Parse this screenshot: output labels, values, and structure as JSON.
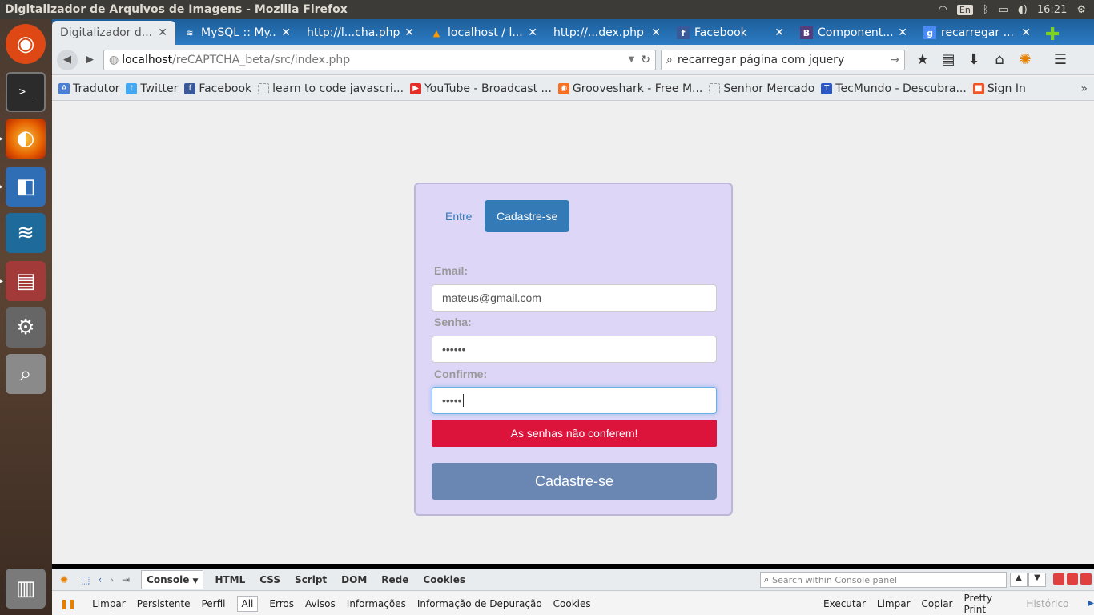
{
  "window": {
    "title": "Digitalizador de Arquivos de Imagens - Mozilla Firefox"
  },
  "tray": {
    "lang": "En",
    "time": "16:21"
  },
  "launcher": {
    "items": [
      {
        "name": "ubuntu-icon",
        "glyph": "◉"
      },
      {
        "name": "terminal-icon",
        "glyph": ">_"
      },
      {
        "name": "firefox-icon",
        "glyph": "◐"
      },
      {
        "name": "virtualbox-icon",
        "glyph": "◧"
      },
      {
        "name": "mysql-workbench-icon",
        "glyph": "≋"
      },
      {
        "name": "file-manager-icon",
        "glyph": "▤"
      },
      {
        "name": "system-settings-icon",
        "glyph": "⚙"
      },
      {
        "name": "search-icon",
        "glyph": "⌕"
      },
      {
        "name": "trash-icon",
        "glyph": "🗑"
      }
    ]
  },
  "tabs": [
    {
      "label": "Digitalizador d...",
      "fav": "",
      "active": true
    },
    {
      "label": "MySQL :: My...",
      "fav": "≋"
    },
    {
      "label": "http://l...cha.php",
      "fav": ""
    },
    {
      "label": "localhost / l...",
      "fav": "▲"
    },
    {
      "label": "http://...dex.php",
      "fav": ""
    },
    {
      "label": "Facebook",
      "fav": "f"
    },
    {
      "label": "Component...",
      "fav": "B"
    },
    {
      "label": "recarregar ...",
      "fav": "g"
    }
  ],
  "nav": {
    "url_host": "localhost",
    "url_path": "/reCAPTCHA_beta/src/index.php",
    "search_value": "recarregar página com jquery"
  },
  "bookmarks": [
    {
      "label": "Tradutor",
      "fav": "A",
      "color": "#4a7fd6"
    },
    {
      "label": "Twitter",
      "fav": "t",
      "color": "#3fa9f5"
    },
    {
      "label": "Facebook",
      "fav": "f",
      "color": "#3b5998"
    },
    {
      "label": "learn to code javascri...",
      "fav": "",
      "color": "#cccccc"
    },
    {
      "label": "YouTube - Broadcast ...",
      "fav": "▶",
      "color": "#e52d27"
    },
    {
      "label": "Grooveshark - Free M...",
      "fav": "◉",
      "color": "#f76f20"
    },
    {
      "label": "Senhor Mercado",
      "fav": "",
      "color": "#cccccc"
    },
    {
      "label": "TecMundo - Descubra...",
      "fav": "T",
      "color": "#2d57c7"
    },
    {
      "label": "Sign In",
      "fav": "■",
      "color": "#f35325"
    }
  ],
  "form": {
    "tab_login": "Entre",
    "tab_register": "Cadastre-se",
    "email_label": "Email:",
    "email_value": "mateus@gmail.com",
    "password_label": "Senha:",
    "password_value": "••••••",
    "confirm_label": "Confirme:",
    "confirm_value": "•••••",
    "error_message": "As senhas não conferem!",
    "submit_label": "Cadastre-se"
  },
  "firebug": {
    "tabs": [
      "Console",
      "HTML",
      "CSS",
      "Script",
      "DOM",
      "Rede",
      "Cookies"
    ],
    "search_placeholder": "Search within Console panel",
    "options_left": [
      "Limpar",
      "Persistente",
      "Perfil"
    ],
    "filters": [
      "All",
      "Erros",
      "Avisos",
      "Informações",
      "Informação de Depuração",
      "Cookies"
    ],
    "options_right": [
      "Executar",
      "Limpar",
      "Copiar",
      "Pretty Print",
      "Histórico"
    ]
  },
  "colors": {
    "primary": "#337ab7",
    "card_bg": "#ddd6f7",
    "error_bg": "#dc143c",
    "submit_bg": "#6a86b3"
  }
}
